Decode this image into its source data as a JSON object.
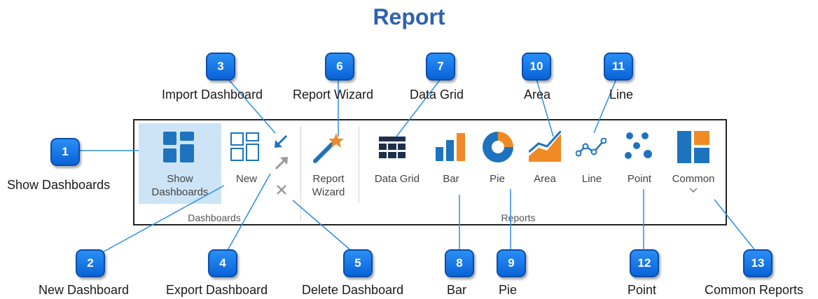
{
  "title": "Report",
  "ribbon": {
    "groups": {
      "dashboards": "Dashboards",
      "reports": "Reports"
    },
    "buttons": {
      "show_dashboards_line1": "Show",
      "show_dashboards_line2": "Dashboards",
      "new": "New",
      "report_wizard_line1": "Report",
      "report_wizard_line2": "Wizard",
      "data_grid": "Data Grid",
      "bar": "Bar",
      "pie": "Pie",
      "area": "Area",
      "line": "Line",
      "point": "Point",
      "common": "Common"
    },
    "colors": {
      "blue": "#1e73be",
      "orange": "#f08a24",
      "selected": "#cde4f6"
    }
  },
  "callouts": {
    "c1": {
      "number": "1",
      "label": "Show Dashboards"
    },
    "c2": {
      "number": "2",
      "label": "New Dashboard"
    },
    "c3": {
      "number": "3",
      "label": "Import Dashboard"
    },
    "c4": {
      "number": "4",
      "label": "Export Dashboard"
    },
    "c5": {
      "number": "5",
      "label": "Delete Dashboard"
    },
    "c6": {
      "number": "6",
      "label": "Report Wizard"
    },
    "c7": {
      "number": "7",
      "label": "Data Grid"
    },
    "c8": {
      "number": "8",
      "label": "Bar"
    },
    "c9": {
      "number": "9",
      "label": "Pie"
    },
    "c10": {
      "number": "10",
      "label": "Area"
    },
    "c11": {
      "number": "11",
      "label": "Line"
    },
    "c12": {
      "number": "12",
      "label": "Point"
    },
    "c13": {
      "number": "13",
      "label": "Common Reports"
    }
  }
}
